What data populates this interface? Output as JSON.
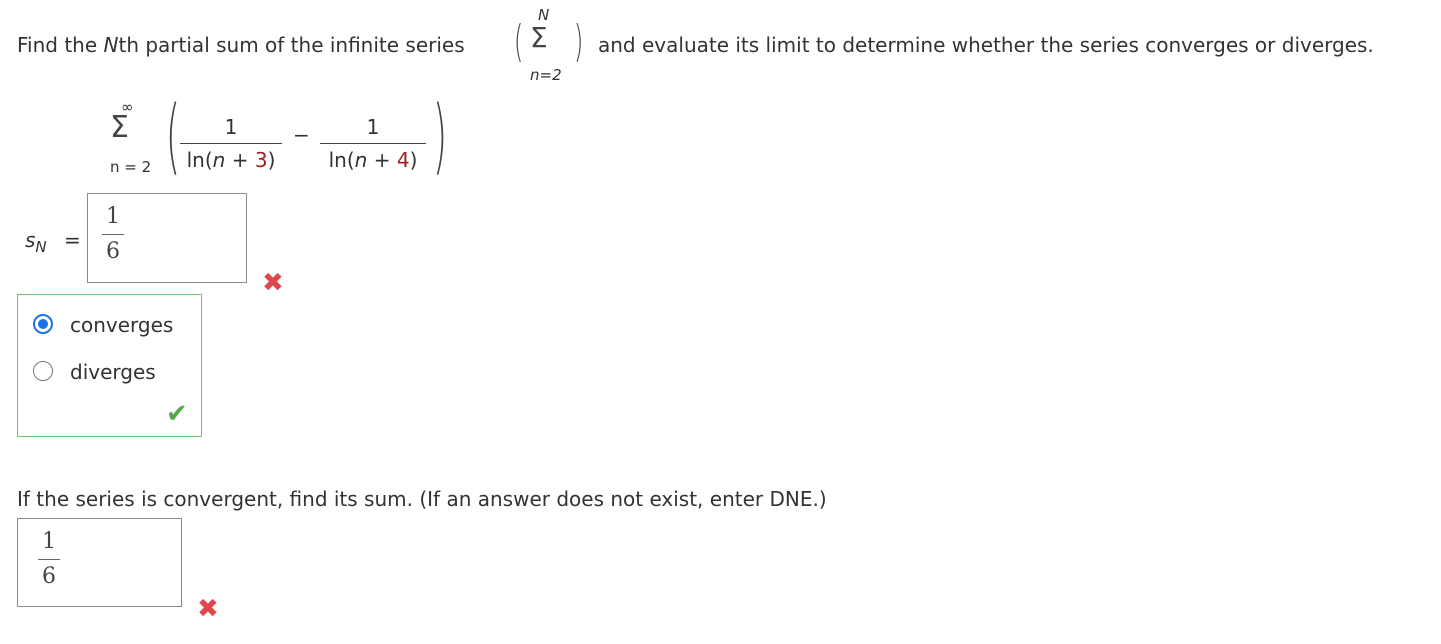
{
  "question": {
    "intro_before": "Find the",
    "intro_N": "N",
    "intro_th": "th partial sum of the infinite series",
    "inline_sum_upper": "N",
    "inline_sum_lower": "n=2",
    "intro_after": "and evaluate its limit to determine whether the series converges or diverges."
  },
  "series": {
    "sum_symbol": "Σ",
    "upper_limit": "∞",
    "lower_limit": "n = 2",
    "term1_num": "1",
    "term1_den_pre": "ln(",
    "term1_den_var": "n",
    "term1_den_plus": " + ",
    "term1_den_const": "3",
    "term1_den_close": ")",
    "operator": "−",
    "term2_num": "1",
    "term2_den_pre": "ln(",
    "term2_den_var": "n",
    "term2_den_plus": " + ",
    "term2_den_const": "4",
    "term2_den_close": ")"
  },
  "sn_answer": {
    "label_s": "s",
    "label_sub": "N",
    "equals": "=",
    "value_num": "1",
    "value_den": "6",
    "status": "incorrect",
    "status_icon": "x-mark-icon"
  },
  "convergence": {
    "options": [
      {
        "label": "converges",
        "selected": true
      },
      {
        "label": "diverges",
        "selected": false
      }
    ],
    "status": "correct",
    "status_icon": "check-mark-icon"
  },
  "sum_question": {
    "prompt": "If the series is convergent, find its sum. (If an answer does not exist, enter DNE.)",
    "value_num": "1",
    "value_den": "6",
    "status": "incorrect",
    "status_icon": "x-mark-icon"
  },
  "colors": {
    "text": "#333333",
    "incorrect": "#e0474c",
    "correct": "#51a94a",
    "radio_selected": "#1a73e8",
    "highlight_number": "#a31f1f"
  }
}
